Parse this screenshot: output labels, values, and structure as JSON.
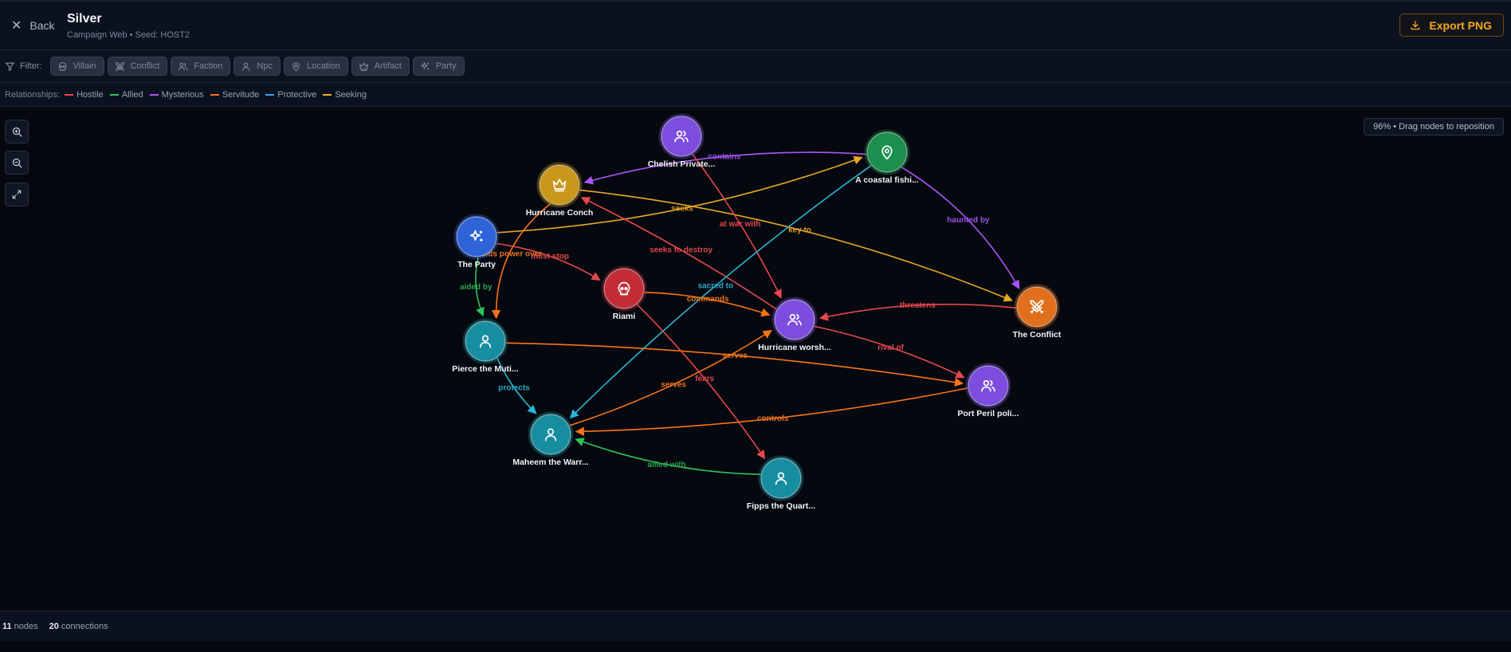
{
  "header": {
    "back_label": "Back",
    "title": "Silver",
    "subtitle": "Campaign Web • Seed: HOST2",
    "export_label": "Export PNG"
  },
  "filter": {
    "label": "Filter:",
    "chips": [
      {
        "label": "Villain",
        "icon": "skull-icon"
      },
      {
        "label": "Conflict",
        "icon": "swords-icon"
      },
      {
        "label": "Faction",
        "icon": "users-icon"
      },
      {
        "label": "Npc",
        "icon": "user-icon"
      },
      {
        "label": "Location",
        "icon": "map-pin-icon"
      },
      {
        "label": "Artifact",
        "icon": "crown-icon"
      },
      {
        "label": "Party",
        "icon": "sparkles-icon"
      }
    ]
  },
  "relationships": {
    "label": "Relationships:",
    "items": [
      {
        "label": "Hostile",
        "color": "#e5484d"
      },
      {
        "label": "Allied",
        "color": "#30c25a"
      },
      {
        "label": "Mysterious",
        "color": "#a855f7"
      },
      {
        "label": "Servitude",
        "color": "#f97316"
      },
      {
        "label": "Protective",
        "color": "#3b9eea"
      },
      {
        "label": "Seeking",
        "color": "#f2b01e"
      }
    ]
  },
  "zoom_info": "96% • Drag nodes to reposition",
  "graph": {
    "nodes": [
      {
        "id": "chelish",
        "label": "Chelish Private...",
        "type": "faction",
        "icon": "users-icon",
        "color": "#7c4dde"
      },
      {
        "id": "coastal",
        "label": "A coastal fishi...",
        "type": "location",
        "icon": "map-pin-icon",
        "color": "#1c8f4e"
      },
      {
        "id": "conch",
        "label": "Hurricane Conch",
        "type": "artifact",
        "icon": "crown-icon",
        "color": "#c9971c"
      },
      {
        "id": "party",
        "label": "The Party",
        "type": "party",
        "icon": "sparkles-icon",
        "color": "#2f64d8"
      },
      {
        "id": "riami",
        "label": "Riami",
        "type": "villain",
        "icon": "skull-icon",
        "color": "#c42c36"
      },
      {
        "id": "worship",
        "label": "Hurricane worsh...",
        "type": "faction",
        "icon": "users-icon",
        "color": "#7c4dde"
      },
      {
        "id": "conflict",
        "label": "The Conflict",
        "type": "conflict",
        "icon": "swords-icon",
        "color": "#e0701e"
      },
      {
        "id": "pierce",
        "label": "Pierce the Muti...",
        "type": "npc",
        "icon": "user-icon",
        "color": "#168ea0"
      },
      {
        "id": "portperil",
        "label": "Port Peril poli...",
        "type": "faction",
        "icon": "users-icon",
        "color": "#7c4dde"
      },
      {
        "id": "maheem",
        "label": "Maheem the Warr...",
        "type": "npc",
        "icon": "user-icon",
        "color": "#168ea0"
      },
      {
        "id": "fipps",
        "label": "Fipps the Quart...",
        "type": "npc",
        "icon": "user-icon",
        "color": "#168ea0"
      }
    ],
    "edges": [
      {
        "from": "coastal",
        "to": "conch",
        "label": "contains",
        "kind": "mysterious"
      },
      {
        "from": "coastal",
        "to": "conflict",
        "label": "haunted by",
        "kind": "mysterious"
      },
      {
        "from": "party",
        "to": "coastal",
        "label": "seeks",
        "kind": "seeking"
      },
      {
        "from": "conch",
        "to": "conflict",
        "label": "key to",
        "kind": "seeking"
      },
      {
        "from": "chelish",
        "to": "worship",
        "label": "at war with",
        "kind": "hostile"
      },
      {
        "from": "worship",
        "to": "conch",
        "label": "seeks to destroy",
        "kind": "hostile"
      },
      {
        "from": "conch",
        "to": "pierce",
        "label": "holds power over",
        "kind": "servitude"
      },
      {
        "from": "party",
        "to": "riami",
        "label": "must stop",
        "kind": "hostile"
      },
      {
        "from": "party",
        "to": "pierce",
        "label": "aided by",
        "kind": "allied"
      },
      {
        "from": "coastal",
        "to": "maheem",
        "label": "sacred to",
        "kind": "protective"
      },
      {
        "from": "riami",
        "to": "worship",
        "label": "commands",
        "kind": "servitude"
      },
      {
        "from": "conflict",
        "to": "worship",
        "label": "threatens",
        "kind": "hostile"
      },
      {
        "from": "worship",
        "to": "portperil",
        "label": "rival of",
        "kind": "hostile"
      },
      {
        "from": "pierce",
        "to": "maheem",
        "label": "protects",
        "kind": "protective"
      },
      {
        "from": "maheem",
        "to": "worship",
        "label": "serves",
        "kind": "servitude"
      },
      {
        "from": "pierce",
        "to": "portperil",
        "label": "serves",
        "kind": "servitude"
      },
      {
        "from": "riami",
        "to": "fipps",
        "label": "fears",
        "kind": "hostile"
      },
      {
        "from": "portperil",
        "to": "maheem",
        "label": "controls",
        "kind": "servitude"
      },
      {
        "from": "fipps",
        "to": "maheem",
        "label": "allied with",
        "kind": "allied"
      }
    ]
  },
  "status": {
    "nodes_count": "11",
    "nodes_label": "nodes",
    "connections_count": "20",
    "connections_label": "connections"
  }
}
